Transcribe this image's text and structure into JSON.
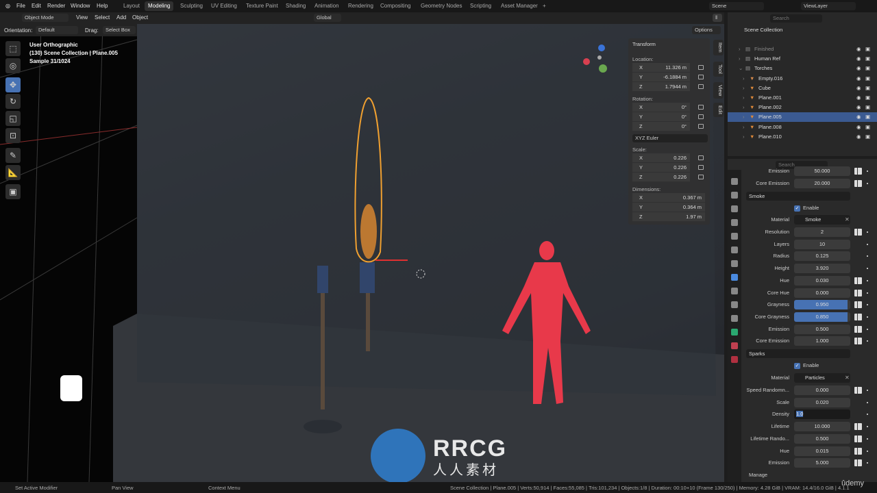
{
  "menubar": {
    "items": [
      "File",
      "Edit",
      "Render",
      "Window",
      "Help"
    ],
    "workspaces": [
      "Layout",
      "Modeling",
      "Sculpting",
      "UV Editing",
      "Texture Paint",
      "Shading",
      "Animation",
      "Rendering",
      "Compositing",
      "Geometry Nodes",
      "Scripting",
      "Asset Manager"
    ],
    "active_workspace": "Modeling",
    "add_tab": "+",
    "scene": "Scene",
    "view_layer": "ViewLayer"
  },
  "header": {
    "mode": "Object Mode",
    "menus": [
      "View",
      "Select",
      "Add",
      "Object"
    ],
    "orientation_global": "Global",
    "options": "Options"
  },
  "toolsettings": {
    "orientation_label": "Orientation:",
    "orientation_value": "Default",
    "drag_label": "Drag:",
    "drag_value": "Select Box"
  },
  "viewport": {
    "info": [
      "User Orthographic",
      "(130) Scene Collection | Plane.005",
      "Sample 31/1024"
    ]
  },
  "npanel": {
    "title": "Transform",
    "location_label": "Location:",
    "location": [
      "11.326 m",
      "-6.1884 m",
      "1.7944 m"
    ],
    "rotation_label": "Rotation:",
    "rotation": [
      "0°",
      "0°",
      "0°"
    ],
    "rotation_mode": "XYZ Euler",
    "scale_label": "Scale:",
    "scale": [
      "0.226",
      "0.226",
      "0.226"
    ],
    "dimensions_label": "Dimensions:",
    "dimensions": [
      "0.367 m",
      "0.364 m",
      "1.97 m"
    ],
    "axes": [
      "X",
      "Y",
      "Z"
    ],
    "tabs": [
      "Item",
      "Tool",
      "View",
      "Edit"
    ]
  },
  "outliner": {
    "search_placeholder": "Search",
    "root": "Scene Collection",
    "items": [
      "Finished",
      "Human Ref",
      "Torches",
      "Empty.016",
      "Cube",
      "Plane.001",
      "Plane.002",
      "Plane.005",
      "Plane.008",
      "Plane.010"
    ],
    "selected": "Plane.005"
  },
  "properties": {
    "search_placeholder": "Search",
    "rows1": [
      [
        "Emission",
        "50.000"
      ],
      [
        "Core Emission",
        "20.000"
      ]
    ],
    "smoke_header": "Smoke",
    "enable": "Enable",
    "material_label": "Material",
    "smoke_material": "Smoke",
    "rows2": [
      [
        "Resolution",
        "2"
      ],
      [
        "Layers",
        "10"
      ],
      [
        "Radius",
        "0.125"
      ],
      [
        "Height",
        "3.920"
      ],
      [
        "Hue",
        "0.030"
      ],
      [
        "Core Hue",
        "0.000"
      ],
      [
        "Grayness",
        "0.950"
      ],
      [
        "Core Grayness",
        "0.850"
      ],
      [
        "Emission",
        "0.500"
      ],
      [
        "Core Emission",
        "1.000"
      ]
    ],
    "sparks_header": "Sparks",
    "sparks_material": "Particles",
    "rows3": [
      [
        "Speed Randomn...",
        "0.000"
      ],
      [
        "Scale",
        "0.020"
      ],
      [
        "Density",
        "1.0"
      ],
      [
        "Lifetime",
        "10.000"
      ],
      [
        "Lifetime Rando...",
        "0.500"
      ],
      [
        "Hue",
        "0.015"
      ],
      [
        "Emission",
        "5.000"
      ]
    ],
    "manage": "Manage",
    "accent": "#4772b3"
  },
  "statusbar": {
    "left": [
      "Set Active Modifier",
      "Pan View",
      "Context Menu"
    ],
    "right": "Scene Collection | Plane.005 | Verts:50,914 | Faces:55,085 | Tris:101,234 | Objects:1/8 | Duration: 00:10+10 (Frame 130/250) | Memory: 4.28 GiB | VRAM: 14.4/16.0 GiB | 4.1.1"
  },
  "watermark": {
    "text": "RRCG",
    "sub": "人人素材",
    "udemy": "ûdemy"
  }
}
